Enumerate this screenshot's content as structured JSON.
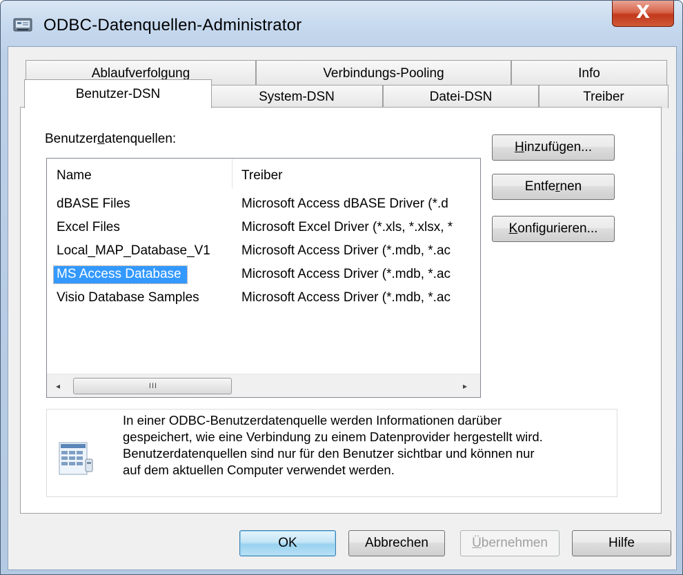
{
  "window": {
    "title": "ODBC-Datenquellen-Administrator",
    "close_glyph": "X",
    "icon": "odbc-admin-icon",
    "close_color": "#c7411f"
  },
  "tabs": {
    "row_back": [
      {
        "label": "Ablaufverfolgung"
      },
      {
        "label": "Verbindungs-Pooling"
      },
      {
        "label": "Info"
      }
    ],
    "row_front": [
      {
        "label": "Benutzer-DSN",
        "active": true
      },
      {
        "label": "System-DSN"
      },
      {
        "label": "Datei-DSN"
      },
      {
        "label": "Treiber"
      }
    ]
  },
  "list": {
    "label_pre": "Benutzer",
    "label_accel": "d",
    "label_post": "atenquellen:",
    "columns": {
      "name": "Name",
      "driver": "Treiber"
    },
    "rows": [
      {
        "name": "dBASE Files",
        "driver": "Microsoft Access dBASE Driver (*.d"
      },
      {
        "name": "Excel Files",
        "driver": "Microsoft Excel Driver (*.xls, *.xlsx, *"
      },
      {
        "name": "Local_MAP_Database_V1",
        "driver": "Microsoft Access Driver (*.mdb, *.ac"
      },
      {
        "name": "MS Access Database",
        "driver": "Microsoft Access Driver (*.mdb, *.ac",
        "selected": true
      },
      {
        "name": "Visio Database Samples",
        "driver": "Microsoft Access Driver (*.mdb, *.ac"
      }
    ],
    "scroll_left_glyph": "◂",
    "scroll_right_glyph": "▸",
    "scroll_grip": "III",
    "selection_color": "#3399ff"
  },
  "side_buttons": {
    "add": {
      "accel": "H",
      "rest": "inzufügen..."
    },
    "remove": {
      "pre": "Entfe",
      "accel": "r",
      "rest": "nen"
    },
    "configure": {
      "accel": "K",
      "rest": "onfigurieren..."
    }
  },
  "info": {
    "icon": "datasource-info-icon",
    "lines": [
      "In einer ODBC-Benutzerdatenquelle werden Informationen darüber",
      "gespeichert, wie eine Verbindung zu einem Datenprovider hergestellt wird.",
      "Benutzerdatenquellen sind nur für den Benutzer sichtbar und können nur",
      "auf dem aktuellen Computer verwendet werden."
    ]
  },
  "footer": {
    "ok": "OK",
    "cancel": "Abbrechen",
    "apply": {
      "accel": "Ü",
      "rest": "bernehmen"
    },
    "help": "Hilfe"
  }
}
